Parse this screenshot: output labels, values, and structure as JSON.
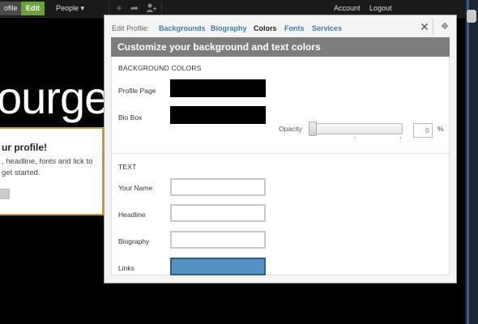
{
  "topbar": {
    "profile_label": "ofile",
    "edit_label": "Edit",
    "people_label": "People ▾",
    "account_label": "Account",
    "logout_label": "Logout"
  },
  "background": {
    "headline": "ourge"
  },
  "callout": {
    "title": "ur profile!",
    "text": ", headline, fonts and lick to get started."
  },
  "modal": {
    "lead": "Edit Profile:",
    "tabs": [
      "Backgrounds",
      "Biography",
      "Colors",
      "Fonts",
      "Services"
    ],
    "active_tab": "Colors",
    "banner": "Customize your background and text colors",
    "background_section": "BACKGROUND COLORS",
    "profile_page_label": "Profile Page",
    "bio_box_label": "Bio Box",
    "opacity_label": "Opacity",
    "opacity_value": "0",
    "opacity_unit": "%",
    "text_section": "TEXT",
    "your_name_label": "Your Name",
    "headline_label": "Headline",
    "biography_label": "Biography",
    "links_label": "Links"
  },
  "colors": {
    "profile_page": "#000000",
    "bio_box": "#000000",
    "your_name": "#ffffff",
    "headline": "#ffffff",
    "biography": "#ffffff",
    "links": "#5592c4",
    "edit_green": "#6aa33c",
    "tab_blue": "#3a7fb5",
    "callout_border": "#c79a3e"
  },
  "icons": [
    "plus-icon",
    "share-arrow-icon",
    "add-user-icon",
    "close-icon",
    "move-icon"
  ]
}
